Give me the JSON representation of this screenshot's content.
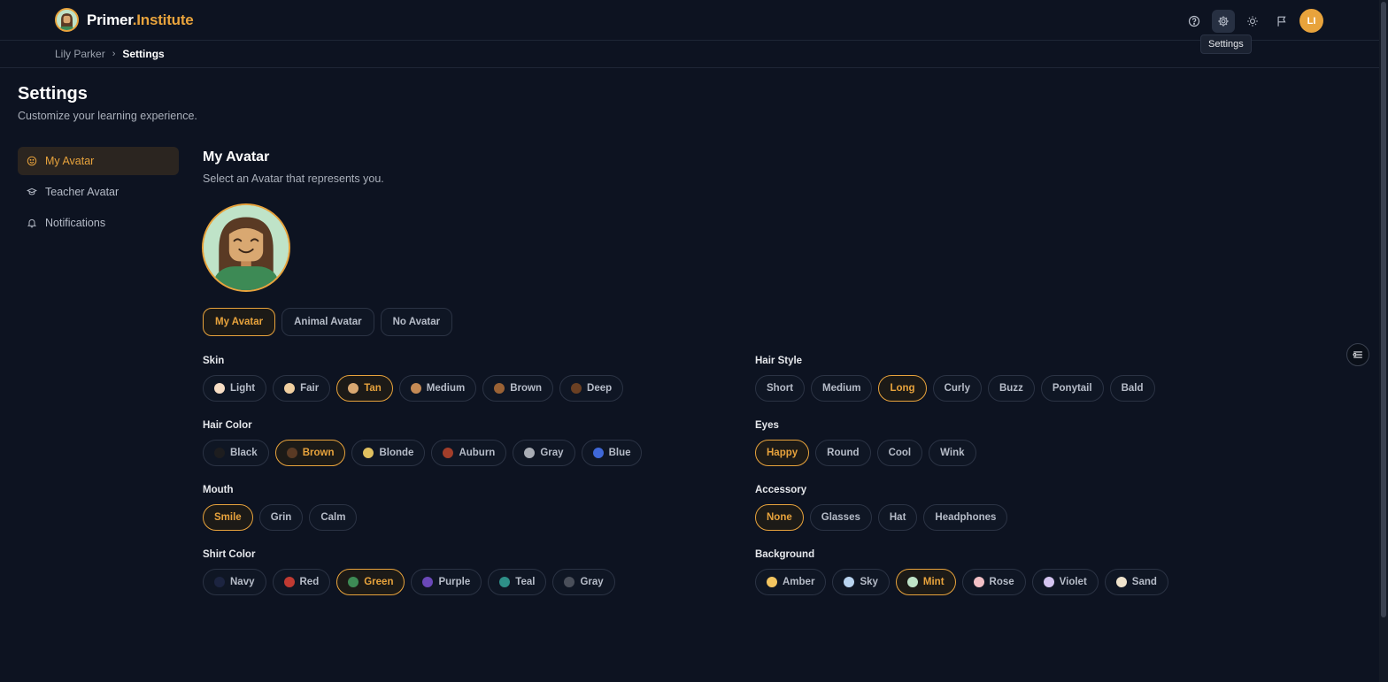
{
  "header": {
    "brand_part1": "Primer",
    "brand_part2": ".Institute",
    "user_initials": "LI",
    "tooltip": "Settings"
  },
  "breadcrumb": {
    "parent": "Lily Parker",
    "current": "Settings"
  },
  "page": {
    "title": "Settings",
    "subtitle": "Customize your learning experience."
  },
  "sidebar": {
    "items": [
      {
        "label": "My Avatar",
        "icon": "smile-icon",
        "active": true
      },
      {
        "label": "Teacher Avatar",
        "icon": "graduation-cap-icon",
        "active": false
      },
      {
        "label": "Notifications",
        "icon": "bell-icon",
        "active": false
      }
    ]
  },
  "section": {
    "title": "My Avatar",
    "subtitle": "Select an Avatar that represents you."
  },
  "modes": [
    {
      "label": "My Avatar",
      "selected": true
    },
    {
      "label": "Animal Avatar",
      "selected": false
    },
    {
      "label": "No Avatar",
      "selected": false
    }
  ],
  "options": {
    "skin": {
      "label": "Skin",
      "items": [
        {
          "label": "Light",
          "color": "#f7dec5",
          "selected": false
        },
        {
          "label": "Fair",
          "color": "#f0cfa0",
          "selected": false
        },
        {
          "label": "Tan",
          "color": "#d9a871",
          "selected": true
        },
        {
          "label": "Medium",
          "color": "#c48a55",
          "selected": false
        },
        {
          "label": "Brown",
          "color": "#9a6235",
          "selected": false
        },
        {
          "label": "Deep",
          "color": "#6b4023",
          "selected": false
        }
      ]
    },
    "hair_color": {
      "label": "Hair Color",
      "items": [
        {
          "label": "Black",
          "color": "#1d1d1f",
          "selected": false
        },
        {
          "label": "Brown",
          "color": "#5a3a24",
          "selected": true
        },
        {
          "label": "Blonde",
          "color": "#e0c060",
          "selected": false
        },
        {
          "label": "Auburn",
          "color": "#a33e2a",
          "selected": false
        },
        {
          "label": "Gray",
          "color": "#a9adb5",
          "selected": false
        },
        {
          "label": "Blue",
          "color": "#3f68d8",
          "selected": false
        }
      ]
    },
    "mouth": {
      "label": "Mouth",
      "items": [
        {
          "label": "Smile",
          "selected": true
        },
        {
          "label": "Grin",
          "selected": false
        },
        {
          "label": "Calm",
          "selected": false
        }
      ]
    },
    "shirt_color": {
      "label": "Shirt Color",
      "items": [
        {
          "label": "Navy",
          "color": "#1c2440",
          "selected": false
        },
        {
          "label": "Red",
          "color": "#c03a32",
          "selected": false
        },
        {
          "label": "Green",
          "color": "#3d8a55",
          "selected": true
        },
        {
          "label": "Purple",
          "color": "#6a48b8",
          "selected": false
        },
        {
          "label": "Teal",
          "color": "#2e8f88",
          "selected": false
        },
        {
          "label": "Gray",
          "color": "#4a4f5a",
          "selected": false
        }
      ]
    },
    "hair_style": {
      "label": "Hair Style",
      "items": [
        {
          "label": "Short",
          "selected": false
        },
        {
          "label": "Medium",
          "selected": false
        },
        {
          "label": "Long",
          "selected": true
        },
        {
          "label": "Curly",
          "selected": false
        },
        {
          "label": "Buzz",
          "selected": false
        },
        {
          "label": "Ponytail",
          "selected": false
        },
        {
          "label": "Bald",
          "selected": false
        }
      ]
    },
    "eyes": {
      "label": "Eyes",
      "items": [
        {
          "label": "Happy",
          "selected": true
        },
        {
          "label": "Round",
          "selected": false
        },
        {
          "label": "Cool",
          "selected": false
        },
        {
          "label": "Wink",
          "selected": false
        }
      ]
    },
    "accessory": {
      "label": "Accessory",
      "items": [
        {
          "label": "None",
          "selected": true
        },
        {
          "label": "Glasses",
          "selected": false
        },
        {
          "label": "Hat",
          "selected": false
        },
        {
          "label": "Headphones",
          "selected": false
        }
      ]
    },
    "background": {
      "label": "Background",
      "items": [
        {
          "label": "Amber",
          "color": "#f3c560",
          "selected": false
        },
        {
          "label": "Sky",
          "color": "#b9d4f0",
          "selected": false
        },
        {
          "label": "Mint",
          "color": "#bfe3c8",
          "selected": true
        },
        {
          "label": "Rose",
          "color": "#f2c0c6",
          "selected": false
        },
        {
          "label": "Violet",
          "color": "#d4c4f0",
          "selected": false
        },
        {
          "label": "Sand",
          "color": "#efe3cc",
          "selected": false
        }
      ]
    }
  },
  "colors": {
    "accent": "#e8a33c",
    "background": "#0d1321"
  }
}
